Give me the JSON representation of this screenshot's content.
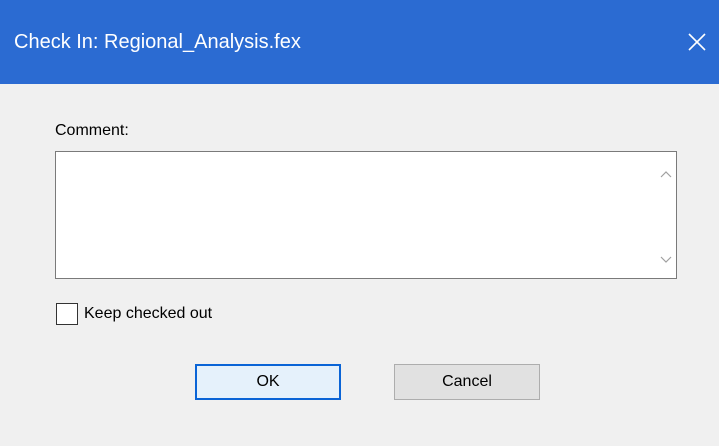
{
  "window": {
    "title": "Check In: Regional_Analysis.fex",
    "close_icon": "close-icon",
    "titlebar_color": "#2b6bd2"
  },
  "form": {
    "comment_label": "Comment:",
    "comment_value": "",
    "keep_checked_out_label": "Keep checked out",
    "keep_checked_out_checked": false
  },
  "buttons": {
    "ok_label": "OK",
    "cancel_label": "Cancel"
  }
}
